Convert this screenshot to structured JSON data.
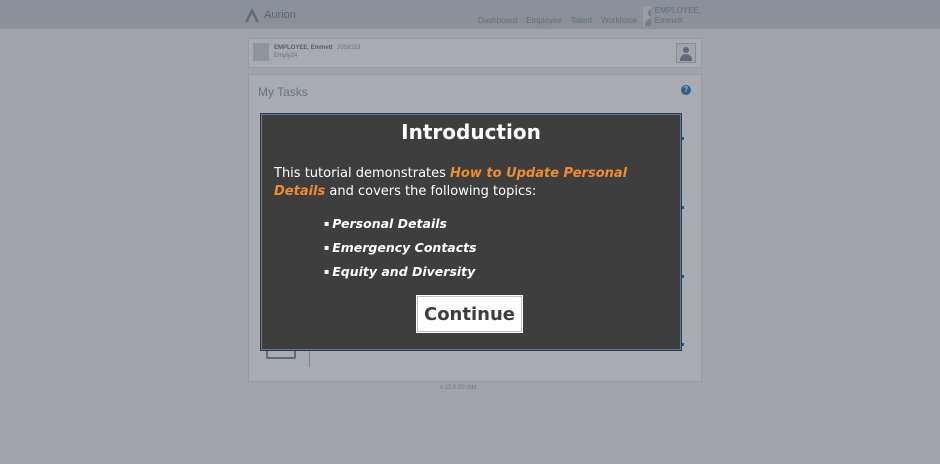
{
  "header": {
    "logo_text": "Aurion",
    "nav": [
      "Dashboard",
      "Employee",
      "Talent",
      "Workforce"
    ],
    "user_line1": "EMPLOYEE,",
    "user_line2": "Emmett"
  },
  "employee_card": {
    "name": "EMPLOYEE, Emmett",
    "id": "2059153",
    "subtitle": "Emply24"
  },
  "tasks": {
    "title": "My Tasks",
    "help_glyph": "?"
  },
  "footer": {
    "version": "v 12.0.00 ddd"
  },
  "modal": {
    "title": "Introduction",
    "body_prefix": "This tutorial demonstrates ",
    "body_highlight": "How to Update Personal Details",
    "body_suffix": " and covers the following topics:",
    "topics": [
      "Personal Details",
      "Emergency Contacts",
      "Equity and Diversity"
    ],
    "continue_label": "Continue"
  },
  "colors": {
    "highlight": "#f28a2e",
    "modal_bg": "#3e3e3e",
    "overlay": "rgba(25,34,46,0.38)"
  }
}
